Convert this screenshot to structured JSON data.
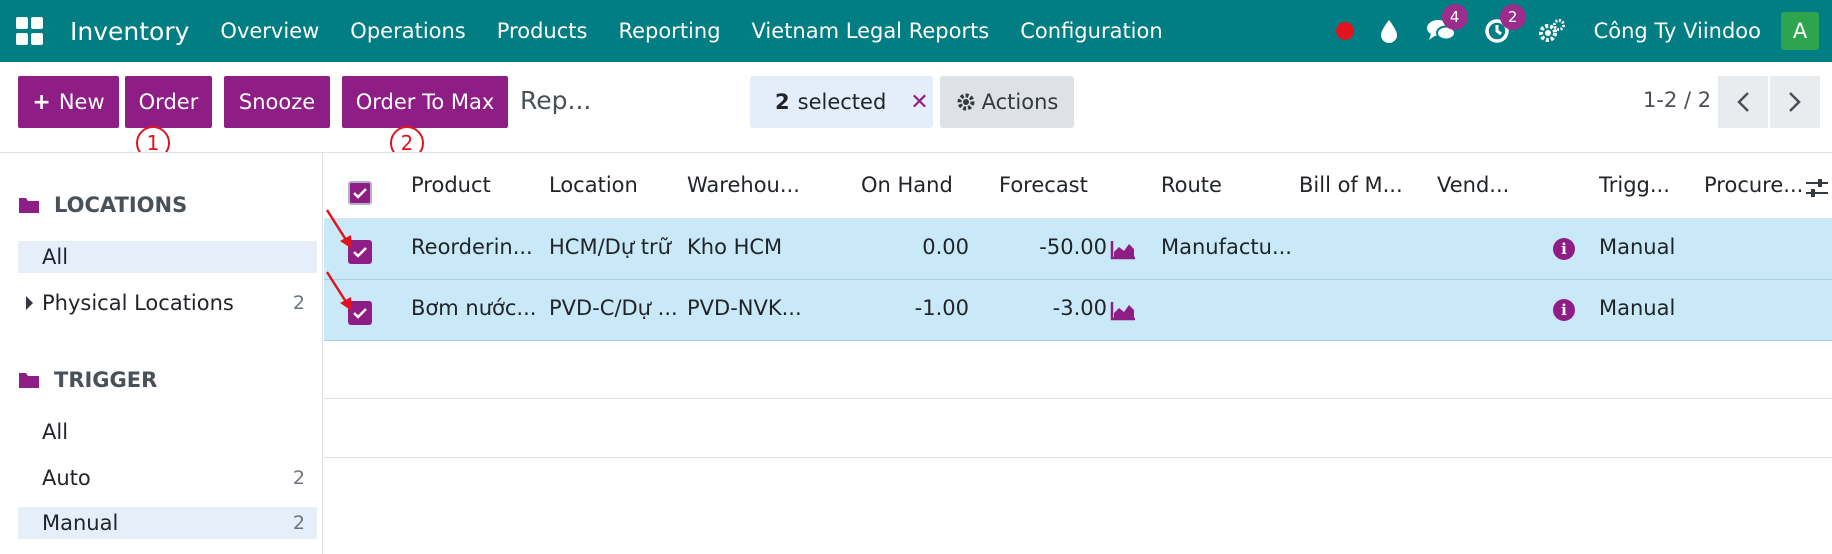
{
  "navbar": {
    "app_name": "Inventory",
    "menu": [
      "Overview",
      "Operations",
      "Products",
      "Reporting",
      "Vietnam Legal Reports",
      "Configuration"
    ],
    "chat_badge": "4",
    "activity_badge": "2",
    "company": "Công Ty Viindoo",
    "avatar_letter": "A",
    "icons": [
      "apps-grid-icon",
      "record-dot-icon",
      "drop-icon",
      "chat-icon",
      "clock-icon",
      "settings-icon"
    ]
  },
  "control": {
    "new_label": "New",
    "order_label": "Order",
    "snooze_label": "Snooze",
    "order_to_max_label": "Order To Max",
    "breadcrumb": "Rep...",
    "selected_count": "2",
    "selected_text": "selected",
    "actions_label": "Actions",
    "pager": "1-2 / 2",
    "marker_1": "1",
    "marker_2": "2"
  },
  "sidebar": {
    "locations_title": "LOCATIONS",
    "locations": [
      {
        "label": "All",
        "count": "",
        "active": true
      },
      {
        "label": "Physical Locations",
        "count": "2",
        "active": false
      }
    ],
    "trigger_title": "TRIGGER",
    "triggers": [
      {
        "label": "All",
        "count": "",
        "active": false
      },
      {
        "label": "Auto",
        "count": "2",
        "active": false
      },
      {
        "label": "Manual",
        "count": "2",
        "active": true
      }
    ]
  },
  "table": {
    "columns": [
      "Product",
      "Location",
      "Warehou...",
      "On Hand",
      "Forecast",
      "Route",
      "Bill of M...",
      "Vend...",
      "Trigg...",
      "Procure..."
    ],
    "rows": [
      {
        "product": "Reorderin...",
        "location": "HCM/Dự trữ",
        "warehouse": "Kho HCM",
        "on_hand": "0.00",
        "forecast": "-50.00",
        "route": "Manufactu...",
        "bom": "",
        "vendor": "",
        "trigger": "Manual",
        "procure": ""
      },
      {
        "product": "Bơm nước...",
        "location": "PVD-C/Dự ...",
        "warehouse": "PVD-NVK...",
        "on_hand": "-1.00",
        "forecast": "-3.00",
        "route": "",
        "bom": "",
        "vendor": "",
        "trigger": "Manual",
        "procure": ""
      }
    ]
  },
  "colors": {
    "navbar": "#017e84",
    "primary": "#8f1d86",
    "selected_row": "#c9e8f8",
    "annotation": "#e0141e"
  }
}
